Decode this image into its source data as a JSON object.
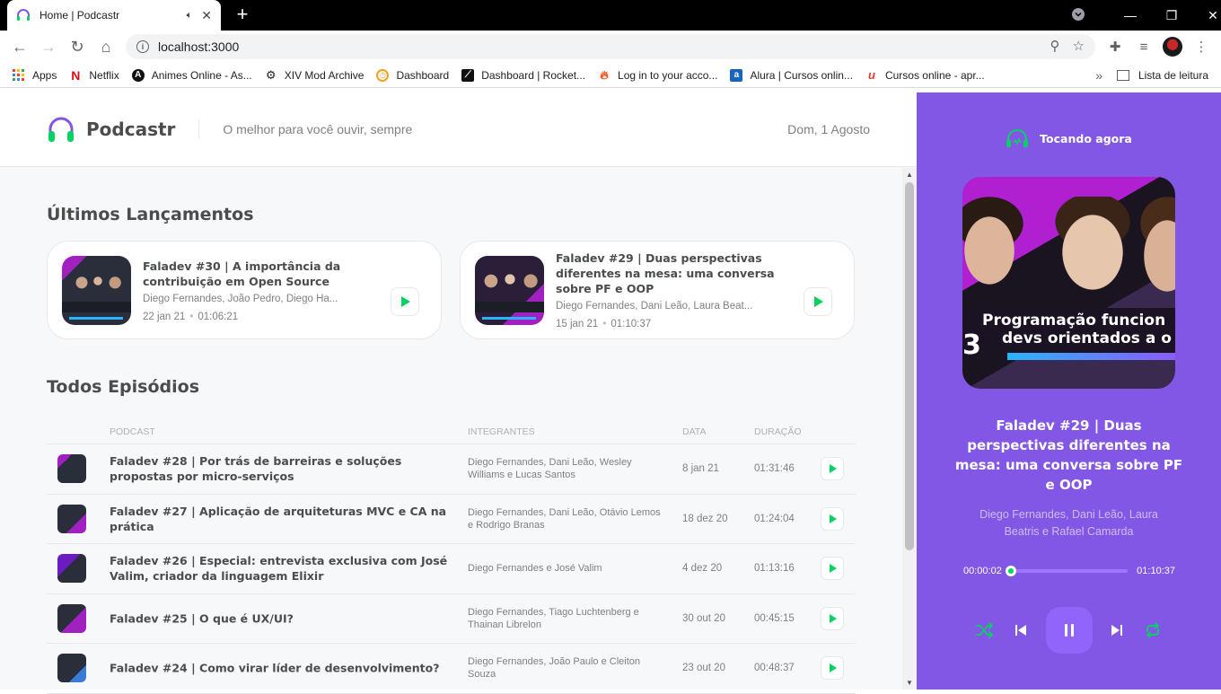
{
  "browser": {
    "tab_title": "Home | Podcastr",
    "url": "localhost:3000",
    "bookmarks": [
      {
        "label": "Apps",
        "icon": "apps-grid-icon"
      },
      {
        "label": "Netflix",
        "icon": "netflix-icon"
      },
      {
        "label": "Animes Online - As...",
        "icon": "anime-icon"
      },
      {
        "label": "XIV Mod Archive",
        "icon": "gear-icon"
      },
      {
        "label": "Dashboard",
        "icon": "dashboard-icon"
      },
      {
        "label": "Dashboard | Rocket...",
        "icon": "rocket-icon"
      },
      {
        "label": "Log in to your acco...",
        "icon": "flame-icon"
      },
      {
        "label": "Alura | Cursos onlin...",
        "icon": "alura-icon"
      },
      {
        "label": "Cursos online - apr...",
        "icon": "udemy-icon"
      }
    ],
    "reading_list": "Lista de leitura"
  },
  "header": {
    "brand": "Podcastr",
    "tagline": "O melhor para você ouvir, sempre",
    "date": "Dom, 1 Agosto"
  },
  "latest": {
    "title": "Últimos Lançamentos",
    "episodes": [
      {
        "title": "Faladev #30 | A importância da contribuição em Open Source",
        "members": "Diego Fernandes, João Pedro, Diego Ha...",
        "date": "22 jan 21",
        "duration": "01:06:21"
      },
      {
        "title": "Faladev #29 | Duas perspectivas diferentes na mesa: uma conversa sobre PF e OOP",
        "members": "Diego Fernandes, Dani Leão, Laura Beat...",
        "date": "15 jan 21",
        "duration": "01:10:37"
      }
    ]
  },
  "all": {
    "title": "Todos Episódios",
    "columns": [
      "Podcast",
      "Integrantes",
      "Data",
      "Duração"
    ],
    "rows": [
      {
        "title": "Faladev #28 | Por trás de barreiras e soluções propostas por micro-serviços",
        "members": "Diego Fernandes, Dani Leão, Wesley Williams e Lucas Santos",
        "date": "8 jan 21",
        "duration": "01:31:46"
      },
      {
        "title": "Faladev #27 | Aplicação de arquiteturas MVC e CA na prática",
        "members": "Diego Fernandes, Dani Leão, Otávio Lemos e Rodrigo Branas",
        "date": "18 dez 20",
        "duration": "01:24:04"
      },
      {
        "title": "Faladev #26 | Especial: entrevista exclusiva com José Valim, criador da linguagem Elixir",
        "members": "Diego Fernandes e José Valim",
        "date": "4 dez 20",
        "duration": "01:13:16"
      },
      {
        "title": "Faladev #25 | O que é UX/UI?",
        "members": "Diego Fernandes, Tiago Luchtenberg e Thainan Librelon",
        "date": "30 out 20",
        "duration": "00:45:15"
      },
      {
        "title": "Faladev #24 | Como virar líder de desenvolvimento?",
        "members": "Diego Fernandes, João Paulo e Cleiton Souza",
        "date": "23 out 20",
        "duration": "00:48:37"
      }
    ]
  },
  "player": {
    "heading": "Tocando agora",
    "title": "Faladev #29 | Duas perspectivas diferentes na mesa: uma conversa sobre PF e OOP",
    "members": "Diego Fernandes, Dani Leão, Laura Beatris e Rafael Camarda",
    "elapsed": "00:00:02",
    "total": "01:10:37",
    "progress_fraction": 0.0005,
    "cover_text_1": "Programação funcion",
    "cover_text_2": "devs orientados a o",
    "cover_number": "3"
  },
  "colors": {
    "purple": "#8257e5",
    "green": "#04d361",
    "text": "#494d4b",
    "muted": "#808080"
  }
}
